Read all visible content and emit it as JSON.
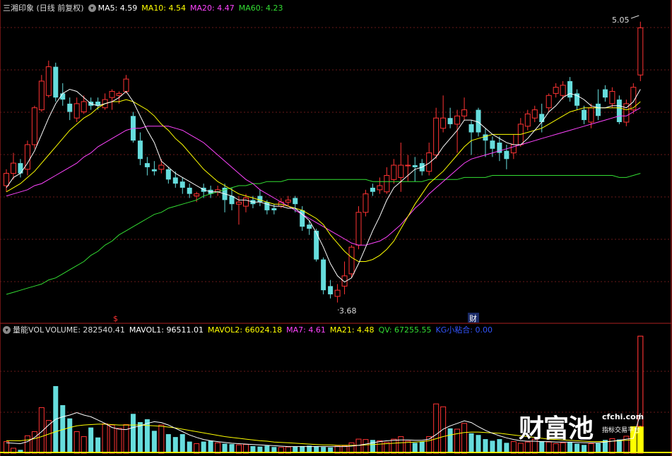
{
  "header_top": {
    "title": "三湘印象 (日线 前复权)",
    "dropdown_icon": "chevron-down-icon",
    "items": [
      {
        "label": "MA5: 4.59",
        "color": "#ffffff"
      },
      {
        "label": "MA10: 4.54",
        "color": "#ffff00"
      },
      {
        "label": "MA20: 4.47",
        "color": "#ff44ff"
      },
      {
        "label": "MA60: 4.23",
        "color": "#33dd33"
      }
    ]
  },
  "header_bottom": {
    "title": "量能VOL",
    "dropdown_icon": "chevron-down-icon",
    "items": [
      {
        "label": "VOLUME: 282540.41",
        "color": "#dddddd"
      },
      {
        "label": "MAVOL1: 96511.01",
        "color": "#ffffff"
      },
      {
        "label": "MAVOL2: 66024.18",
        "color": "#ffff00"
      },
      {
        "label": "MA7: 4.61",
        "color": "#ff44ff"
      },
      {
        "label": "MA21: 4.48",
        "color": "#ffff00"
      },
      {
        "label": "QV: 67255.55",
        "color": "#33dd33"
      },
      {
        "label": "KG小粘合: 0.00",
        "color": "#3355ff"
      }
    ]
  },
  "annotations": {
    "high_label": "5.05",
    "low_label": "3.68",
    "marker_s": "$",
    "marker_cai": "财"
  },
  "watermark": {
    "brand": "财富池",
    "url": "cfchi.com",
    "slogan": "指标交易平台"
  },
  "colors": {
    "up": "#ff3333",
    "down": "#66dddd",
    "ma5": "#ffffff",
    "ma10": "#ffff00",
    "ma20": "#ff44ff",
    "ma60": "#33dd33",
    "grid": "#6a1a1a",
    "vol_highlight": "#ffff00"
  },
  "chart_data": {
    "type": "candlestick",
    "price_range": [
      3.62,
      5.08
    ],
    "candles": [
      {
        "o": 4.25,
        "c": 4.31,
        "h": 4.33,
        "l": 4.22
      },
      {
        "o": 4.31,
        "c": 4.36,
        "h": 4.41,
        "l": 4.28
      },
      {
        "o": 4.36,
        "c": 4.31,
        "h": 4.38,
        "l": 4.29
      },
      {
        "o": 4.33,
        "c": 4.45,
        "h": 4.47,
        "l": 4.3
      },
      {
        "o": 4.45,
        "c": 4.63,
        "h": 4.64,
        "l": 4.43
      },
      {
        "o": 4.62,
        "c": 4.76,
        "h": 4.79,
        "l": 4.61
      },
      {
        "o": 4.69,
        "c": 4.83,
        "h": 4.86,
        "l": 4.68
      },
      {
        "o": 4.83,
        "c": 4.68,
        "h": 4.85,
        "l": 4.66
      },
      {
        "o": 4.7,
        "c": 4.67,
        "h": 4.75,
        "l": 4.64
      },
      {
        "o": 4.65,
        "c": 4.61,
        "h": 4.68,
        "l": 4.57
      },
      {
        "o": 4.58,
        "c": 4.65,
        "h": 4.68,
        "l": 4.56
      },
      {
        "o": 4.61,
        "c": 4.66,
        "h": 4.69,
        "l": 4.6
      },
      {
        "o": 4.66,
        "c": 4.64,
        "h": 4.68,
        "l": 4.62
      },
      {
        "o": 4.66,
        "c": 4.64,
        "h": 4.68,
        "l": 4.62
      },
      {
        "o": 4.63,
        "c": 4.67,
        "h": 4.7,
        "l": 4.62
      },
      {
        "o": 4.68,
        "c": 4.71,
        "h": 4.72,
        "l": 4.62
      },
      {
        "o": 4.69,
        "c": 4.7,
        "h": 4.71,
        "l": 4.65
      },
      {
        "o": 4.71,
        "c": 4.77,
        "h": 4.79,
        "l": 4.7
      },
      {
        "o": 4.59,
        "c": 4.47,
        "h": 4.61,
        "l": 4.46
      },
      {
        "o": 4.47,
        "c": 4.38,
        "h": 4.51,
        "l": 4.35
      },
      {
        "o": 4.36,
        "c": 4.34,
        "h": 4.39,
        "l": 4.3
      },
      {
        "o": 4.33,
        "c": 4.32,
        "h": 4.37,
        "l": 4.3
      },
      {
        "o": 4.33,
        "c": 4.35,
        "h": 4.38,
        "l": 4.31
      },
      {
        "o": 4.33,
        "c": 4.28,
        "h": 4.34,
        "l": 4.26
      },
      {
        "o": 4.29,
        "c": 4.26,
        "h": 4.32,
        "l": 4.24
      },
      {
        "o": 4.27,
        "c": 4.24,
        "h": 4.29,
        "l": 4.21
      },
      {
        "o": 4.24,
        "c": 4.21,
        "h": 4.26,
        "l": 4.19
      },
      {
        "o": 4.2,
        "c": 4.21,
        "h": 4.22,
        "l": 4.17
      },
      {
        "o": 4.24,
        "c": 4.22,
        "h": 4.26,
        "l": 4.19
      },
      {
        "o": 4.23,
        "c": 4.21,
        "h": 4.25,
        "l": 4.19
      },
      {
        "o": 4.22,
        "c": 4.23,
        "h": 4.25,
        "l": 4.2
      },
      {
        "o": 4.24,
        "c": 4.18,
        "h": 4.26,
        "l": 4.12
      },
      {
        "o": 4.2,
        "c": 4.16,
        "h": 4.24,
        "l": 4.13
      },
      {
        "o": 4.16,
        "c": 4.17,
        "h": 4.2,
        "l": 4.06
      },
      {
        "o": 4.15,
        "c": 4.19,
        "h": 4.21,
        "l": 4.12
      },
      {
        "o": 4.18,
        "c": 4.16,
        "h": 4.2,
        "l": 4.14
      },
      {
        "o": 4.2,
        "c": 4.17,
        "h": 4.23,
        "l": 4.15
      },
      {
        "o": 4.17,
        "c": 4.13,
        "h": 4.18,
        "l": 4.11
      },
      {
        "o": 4.14,
        "c": 4.13,
        "h": 4.16,
        "l": 4.11
      },
      {
        "o": 4.15,
        "c": 4.17,
        "h": 4.19,
        "l": 4.14
      },
      {
        "o": 4.17,
        "c": 4.18,
        "h": 4.2,
        "l": 4.15
      },
      {
        "o": 4.19,
        "c": 4.16,
        "h": 4.2,
        "l": 4.12
      },
      {
        "o": 4.13,
        "c": 4.05,
        "h": 4.15,
        "l": 4.03
      },
      {
        "o": 4.06,
        "c": 4.04,
        "h": 4.08,
        "l": 4.01
      },
      {
        "o": 4.03,
        "c": 3.89,
        "h": 4.04,
        "l": 3.88
      },
      {
        "o": 3.89,
        "c": 3.74,
        "h": 3.9,
        "l": 3.72
      },
      {
        "o": 3.76,
        "c": 3.72,
        "h": 3.79,
        "l": 3.7
      },
      {
        "o": 3.71,
        "c": 3.74,
        "h": 3.77,
        "l": 3.68
      },
      {
        "o": 3.76,
        "c": 3.81,
        "h": 3.88,
        "l": 3.72
      },
      {
        "o": 3.82,
        "c": 3.95,
        "h": 3.96,
        "l": 3.8
      },
      {
        "o": 3.96,
        "c": 4.12,
        "h": 4.15,
        "l": 3.94
      },
      {
        "o": 4.12,
        "c": 4.21,
        "h": 4.23,
        "l": 4.1
      },
      {
        "o": 4.24,
        "c": 4.22,
        "h": 4.26,
        "l": 4.2
      },
      {
        "o": 4.23,
        "c": 4.25,
        "h": 4.29,
        "l": 4.21
      },
      {
        "o": 4.22,
        "c": 4.3,
        "h": 4.34,
        "l": 4.21
      },
      {
        "o": 4.28,
        "c": 4.35,
        "h": 4.38,
        "l": 4.26
      },
      {
        "o": 4.29,
        "c": 4.35,
        "h": 4.46,
        "l": 4.22
      },
      {
        "o": 4.35,
        "c": 4.35,
        "h": 4.4,
        "l": 4.27
      },
      {
        "o": 4.35,
        "c": 4.34,
        "h": 4.39,
        "l": 4.27
      },
      {
        "o": 4.36,
        "c": 4.32,
        "h": 4.38,
        "l": 4.3
      },
      {
        "o": 4.32,
        "c": 4.41,
        "h": 4.46,
        "l": 4.3
      },
      {
        "o": 4.4,
        "c": 4.58,
        "h": 4.63,
        "l": 4.38
      },
      {
        "o": 4.53,
        "c": 4.58,
        "h": 4.69,
        "l": 4.51
      },
      {
        "o": 4.58,
        "c": 4.55,
        "h": 4.63,
        "l": 4.53
      },
      {
        "o": 4.55,
        "c": 4.59,
        "h": 4.62,
        "l": 4.41
      },
      {
        "o": 4.59,
        "c": 4.62,
        "h": 4.68,
        "l": 4.57
      },
      {
        "o": 4.55,
        "c": 4.51,
        "h": 4.57,
        "l": 4.4
      },
      {
        "o": 4.62,
        "c": 4.51,
        "h": 4.63,
        "l": 4.49
      },
      {
        "o": 4.5,
        "c": 4.47,
        "h": 4.53,
        "l": 4.39
      },
      {
        "o": 4.47,
        "c": 4.43,
        "h": 4.49,
        "l": 4.39
      },
      {
        "o": 4.46,
        "c": 4.41,
        "h": 4.49,
        "l": 4.37
      },
      {
        "o": 4.42,
        "c": 4.38,
        "h": 4.45,
        "l": 4.33
      },
      {
        "o": 4.41,
        "c": 4.45,
        "h": 4.5,
        "l": 4.38
      },
      {
        "o": 4.45,
        "c": 4.55,
        "h": 4.58,
        "l": 4.44
      },
      {
        "o": 4.54,
        "c": 4.6,
        "h": 4.62,
        "l": 4.52
      },
      {
        "o": 4.58,
        "c": 4.62,
        "h": 4.64,
        "l": 4.56
      },
      {
        "o": 4.6,
        "c": 4.56,
        "h": 4.65,
        "l": 4.51
      },
      {
        "o": 4.63,
        "c": 4.69,
        "h": 4.7,
        "l": 4.61
      },
      {
        "o": 4.7,
        "c": 4.73,
        "h": 4.75,
        "l": 4.68
      },
      {
        "o": 4.69,
        "c": 4.74,
        "h": 4.76,
        "l": 4.67
      },
      {
        "o": 4.76,
        "c": 4.68,
        "h": 4.78,
        "l": 4.66
      },
      {
        "o": 4.7,
        "c": 4.64,
        "h": 4.72,
        "l": 4.62
      },
      {
        "o": 4.62,
        "c": 4.57,
        "h": 4.64,
        "l": 4.55
      },
      {
        "o": 4.56,
        "c": 4.63,
        "h": 4.65,
        "l": 4.53
      },
      {
        "o": 4.65,
        "c": 4.59,
        "h": 4.72,
        "l": 4.57
      },
      {
        "o": 4.72,
        "c": 4.68,
        "h": 4.74,
        "l": 4.66
      },
      {
        "o": 4.65,
        "c": 4.71,
        "h": 4.73,
        "l": 4.63
      },
      {
        "o": 4.67,
        "c": 4.56,
        "h": 4.69,
        "l": 4.55
      },
      {
        "o": 4.56,
        "c": 4.65,
        "h": 4.67,
        "l": 4.54
      },
      {
        "o": 4.62,
        "c": 4.73,
        "h": 4.75,
        "l": 4.6
      },
      {
        "o": 4.79,
        "c": 5.02,
        "h": 5.05,
        "l": 4.76
      }
    ],
    "ma5": [
      4.24,
      4.29,
      4.31,
      4.36,
      4.42,
      4.5,
      4.58,
      4.65,
      4.7,
      4.72,
      4.71,
      4.68,
      4.65,
      4.64,
      4.65,
      4.66,
      4.68,
      4.71,
      4.66,
      4.59,
      4.52,
      4.46,
      4.37,
      4.34,
      4.31,
      4.29,
      4.27,
      4.25,
      4.23,
      4.22,
      4.22,
      4.21,
      4.2,
      4.18,
      4.18,
      4.17,
      4.17,
      4.16,
      4.15,
      4.15,
      4.14,
      4.14,
      4.11,
      4.08,
      4.02,
      3.95,
      3.87,
      3.81,
      3.78,
      3.8,
      3.87,
      3.95,
      4.03,
      4.1,
      4.18,
      4.24,
      4.27,
      4.3,
      4.33,
      4.34,
      4.36,
      4.39,
      4.44,
      4.48,
      4.52,
      4.57,
      4.57,
      4.56,
      4.53,
      4.5,
      4.48,
      4.46,
      4.45,
      4.45,
      4.48,
      4.52,
      4.56,
      4.61,
      4.64,
      4.68,
      4.7,
      4.69,
      4.67,
      4.64,
      4.63,
      4.63,
      4.64,
      4.64,
      4.63,
      4.66,
      4.72
    ],
    "ma10": [
      4.22,
      4.24,
      4.26,
      4.29,
      4.32,
      4.36,
      4.4,
      4.44,
      4.48,
      4.52,
      4.55,
      4.58,
      4.6,
      4.63,
      4.65,
      4.66,
      4.66,
      4.67,
      4.66,
      4.64,
      4.62,
      4.59,
      4.55,
      4.52,
      4.48,
      4.45,
      4.41,
      4.37,
      4.33,
      4.3,
      4.27,
      4.25,
      4.23,
      4.21,
      4.2,
      4.19,
      4.18,
      4.17,
      4.16,
      4.16,
      4.15,
      4.14,
      4.13,
      4.11,
      4.09,
      4.06,
      4.01,
      3.97,
      3.93,
      3.9,
      3.88,
      3.88,
      3.89,
      3.91,
      3.94,
      3.98,
      4.04,
      4.1,
      4.16,
      4.21,
      4.26,
      4.29,
      4.32,
      4.36,
      4.4,
      4.44,
      4.47,
      4.48,
      4.49,
      4.5,
      4.5,
      4.5,
      4.5,
      4.5,
      4.51,
      4.52,
      4.53,
      4.55,
      4.57,
      4.59,
      4.61,
      4.62,
      4.63,
      4.63,
      4.63,
      4.63,
      4.63,
      4.63,
      4.62,
      4.63,
      4.66
    ],
    "ma20": [
      4.2,
      4.21,
      4.22,
      4.23,
      4.25,
      4.26,
      4.28,
      4.3,
      4.32,
      4.34,
      4.36,
      4.39,
      4.41,
      4.44,
      4.46,
      4.48,
      4.5,
      4.52,
      4.53,
      4.53,
      4.54,
      4.54,
      4.54,
      4.54,
      4.53,
      4.52,
      4.5,
      4.48,
      4.46,
      4.43,
      4.4,
      4.37,
      4.34,
      4.31,
      4.28,
      4.26,
      4.23,
      4.21,
      4.19,
      4.17,
      4.15,
      4.13,
      4.11,
      4.09,
      4.07,
      4.05,
      4.03,
      4.01,
      3.99,
      3.97,
      3.96,
      3.96,
      3.97,
      3.98,
      4.0,
      4.03,
      4.06,
      4.1,
      4.14,
      4.17,
      4.21,
      4.24,
      4.27,
      4.3,
      4.33,
      4.36,
      4.38,
      4.39,
      4.4,
      4.41,
      4.42,
      4.43,
      4.44,
      4.45,
      4.46,
      4.47,
      4.48,
      4.49,
      4.5,
      4.51,
      4.52,
      4.53,
      4.54,
      4.55,
      4.56,
      4.57,
      4.58,
      4.59,
      4.59,
      4.61,
      4.63
    ],
    "ma60": [
      3.72,
      3.73,
      3.74,
      3.75,
      3.76,
      3.77,
      3.79,
      3.8,
      3.82,
      3.84,
      3.86,
      3.88,
      3.91,
      3.93,
      3.96,
      3.98,
      4.01,
      4.03,
      4.05,
      4.07,
      4.09,
      4.11,
      4.12,
      4.14,
      4.15,
      4.16,
      4.17,
      4.18,
      4.2,
      4.21,
      4.22,
      4.23,
      4.24,
      4.25,
      4.25,
      4.26,
      4.26,
      4.27,
      4.27,
      4.27,
      4.28,
      4.28,
      4.28,
      4.28,
      4.28,
      4.28,
      4.28,
      4.28,
      4.28,
      4.28,
      4.28,
      4.28,
      4.27,
      4.27,
      4.27,
      4.27,
      4.27,
      4.27,
      4.27,
      4.27,
      4.28,
      4.28,
      4.28,
      4.28,
      4.28,
      4.29,
      4.29,
      4.29,
      4.29,
      4.3,
      4.3,
      4.3,
      4.3,
      4.3,
      4.3,
      4.3,
      4.3,
      4.3,
      4.3,
      4.3,
      4.3,
      4.3,
      4.3,
      4.3,
      4.3,
      4.3,
      4.3,
      4.29,
      4.29,
      4.3,
      4.31
    ],
    "volume_range": [
      0,
      283000
    ],
    "volume": [
      28000,
      12000,
      8000,
      42000,
      52000,
      110000,
      79000,
      162000,
      116000,
      84000,
      52000,
      40000,
      62000,
      38000,
      71000,
      68000,
      60000,
      69000,
      95000,
      75000,
      82000,
      54000,
      68000,
      46000,
      39000,
      46000,
      28000,
      23000,
      28000,
      30000,
      25000,
      23000,
      22000,
      20000,
      21000,
      17000,
      16000,
      18000,
      15000,
      14000,
      15000,
      16000,
      17000,
      18000,
      17000,
      15000,
      14000,
      17000,
      18000,
      25000,
      34000,
      33000,
      32000,
      30000,
      26000,
      34000,
      40000,
      29000,
      25000,
      28000,
      40000,
      119000,
      112000,
      60000,
      58000,
      72000,
      48000,
      44000,
      34000,
      30000,
      34000,
      25000,
      28000,
      24000,
      27000,
      34000,
      29000,
      27000,
      23000,
      25000,
      27000,
      23000,
      20000,
      23000,
      24000,
      32000,
      35000,
      33000,
      41000,
      37000,
      282540
    ],
    "mavol1": [
      25000,
      24000,
      23000,
      28000,
      38000,
      52000,
      68000,
      82000,
      88000,
      92000,
      98000,
      92000,
      88000,
      80000,
      72000,
      62000,
      58000,
      57000,
      62000,
      66000,
      72000,
      76000,
      74000,
      68000,
      60000,
      52000,
      44000,
      38000,
      33000,
      30000,
      28000,
      26000,
      24000,
      23000,
      22000,
      21000,
      20000,
      19000,
      18000,
      17000,
      16000,
      16000,
      16000,
      16000,
      16000,
      16000,
      16000,
      16000,
      16000,
      17000,
      19000,
      22000,
      25000,
      28000,
      30000,
      31000,
      32000,
      32000,
      31000,
      31000,
      34000,
      45000,
      58000,
      66000,
      72000,
      78000,
      74000,
      64000,
      55000,
      48000,
      42000,
      37000,
      33000,
      30000,
      29000,
      29000,
      28000,
      28000,
      27000,
      27000,
      27000,
      26000,
      25000,
      25000,
      25000,
      27000,
      29000,
      31000,
      34000,
      36000,
      96511
    ],
    "mavol2": [
      30000,
      30000,
      30000,
      32000,
      35000,
      40000,
      46000,
      52000,
      57000,
      62000,
      66000,
      68000,
      69000,
      70000,
      70000,
      69000,
      68000,
      68000,
      68000,
      68000,
      67000,
      66000,
      65000,
      63000,
      61000,
      58000,
      55000,
      52000,
      49000,
      46000,
      43000,
      40000,
      38000,
      36000,
      34000,
      32000,
      30000,
      29000,
      27000,
      26000,
      25000,
      24000,
      23000,
      22000,
      21000,
      20000,
      20000,
      19000,
      19000,
      19000,
      19000,
      20000,
      21000,
      22000,
      23000,
      24000,
      25000,
      26000,
      27000,
      28000,
      30000,
      35000,
      40000,
      44000,
      47000,
      50000,
      51000,
      51000,
      50000,
      49000,
      48000,
      46000,
      44000,
      42000,
      40000,
      38000,
      36000,
      34000,
      33000,
      32000,
      31000,
      30000,
      29000,
      28000,
      28000,
      28000,
      29000,
      30000,
      31000,
      32000,
      66024
    ]
  }
}
